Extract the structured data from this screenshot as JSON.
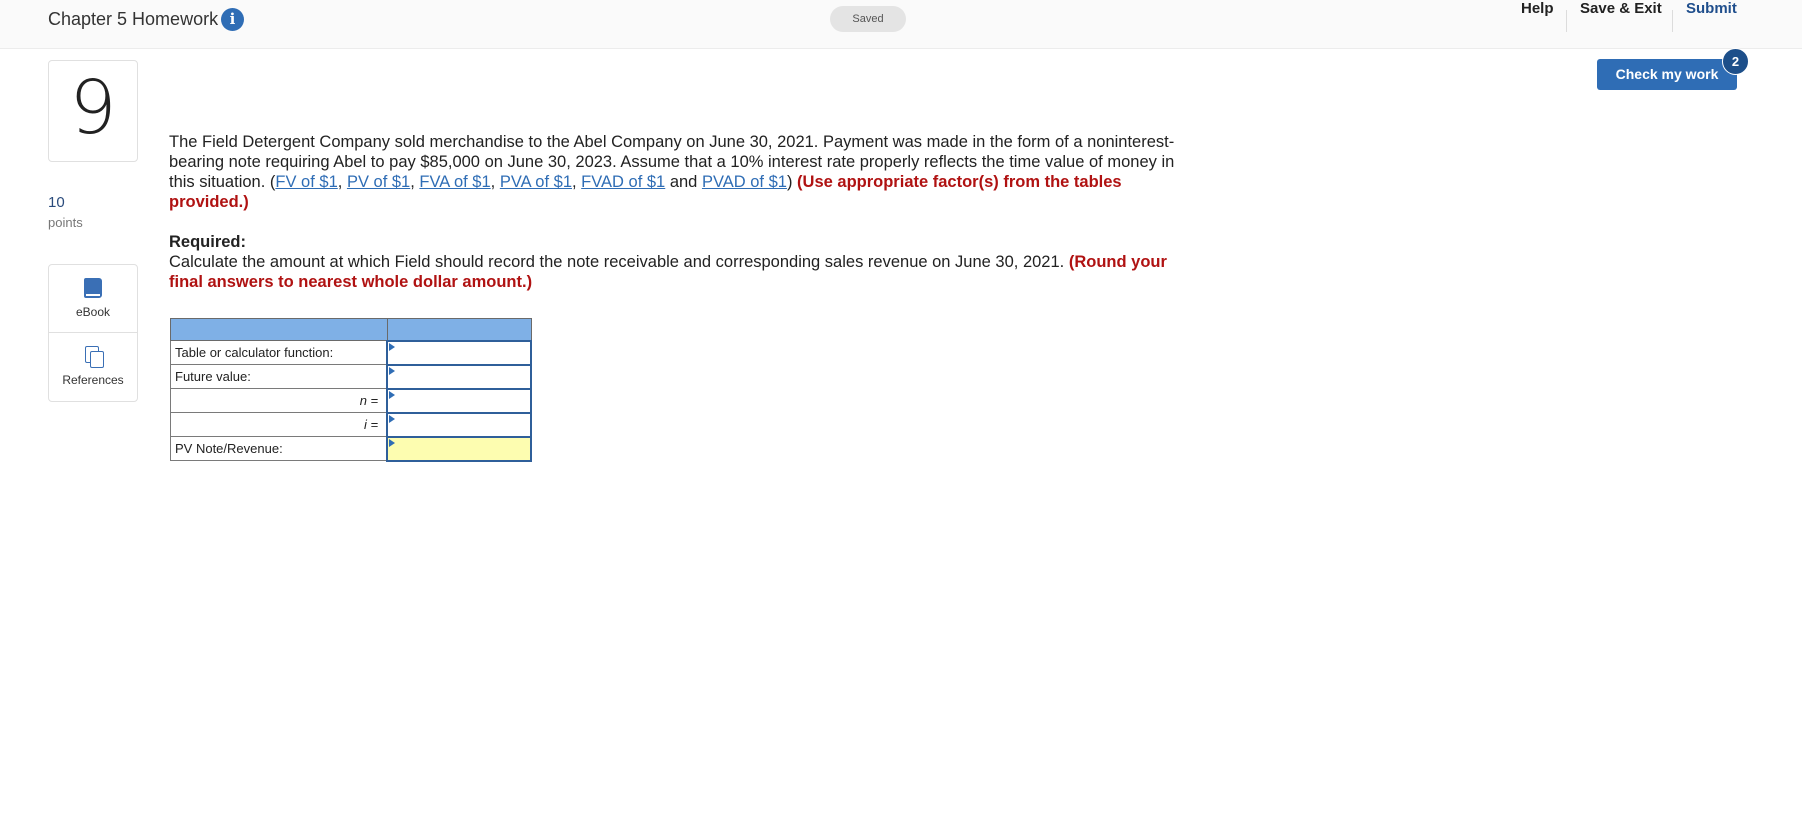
{
  "header": {
    "assignment_title": "Chapter 5 Homework",
    "info_icon": "info-icon",
    "saved_status": "Saved",
    "links": {
      "help": "Help",
      "save_exit": "Save & Exit",
      "submit": "Submit"
    }
  },
  "check_work": {
    "label": "Check my work",
    "badge_count": "2"
  },
  "question": {
    "number": "9",
    "points_value": "10",
    "points_label": "points",
    "tools": {
      "ebook": "eBook",
      "references": "References"
    },
    "intro": "The Field Detergent Company sold merchandise to the Abel Company on June 30, 2021. Payment was made in the form of a noninterest-bearing note requiring Abel to pay $85,000 on June 30, 2023. Assume that a 10% interest rate properly reflects the time value of money in this situation. (",
    "factor_links": [
      "FV of $1",
      "PV of $1",
      "FVA of $1",
      "PVA of $1",
      "FVAD of $1",
      "PVAD of $1"
    ],
    "sep_comma": ", ",
    "sep_and": " and ",
    "close_paren": ") ",
    "instruction": "(Use appropriate factor(s) from the tables provided.)",
    "required_heading": "Required:",
    "required_text": "Calculate the amount at which Field should record the note receivable and corresponding sales revenue on June 30, 2021. ",
    "required_instruction": "(Round your final answers to nearest whole dollar amount.)"
  },
  "answer_table": {
    "rows": [
      {
        "label": "Table or calculator function:",
        "value": ""
      },
      {
        "label": "Future value:",
        "value": ""
      },
      {
        "label": "n =",
        "value": ""
      },
      {
        "label": "i =",
        "value": ""
      },
      {
        "label": "PV Note/Revenue:",
        "value": ""
      }
    ]
  },
  "colors": {
    "accent": "#2f6db5",
    "instruction_red": "#b01212",
    "table_header": "#7fb0e6",
    "highlight_input": "#fdfdb0"
  }
}
